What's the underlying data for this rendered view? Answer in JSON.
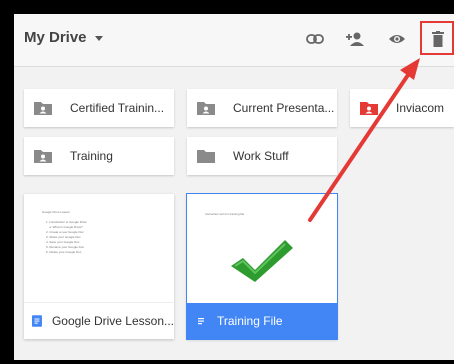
{
  "header": {
    "title": "My Drive",
    "icons": [
      "link-icon",
      "add-person-icon",
      "eye-icon",
      "trash-icon"
    ]
  },
  "folders": [
    {
      "label": "Certified Trainin...",
      "color": "#8a8a8a"
    },
    {
      "label": "Current Presenta...",
      "color": "#8a8a8a"
    },
    {
      "label": "Inviacom",
      "color": "#e53935"
    },
    {
      "label": "Training",
      "color": "#8a8a8a"
    },
    {
      "label": "Work Stuff",
      "color": "#8a8a8a"
    }
  ],
  "files": [
    {
      "label": "Google Drive Lesson...",
      "preview_title": "Google Drive Lesson",
      "preview_lines": [
        "1. Introduction to Google Drive",
        "    a. What is Google Drive?",
        "2. Create a new Google Doc",
        "3. Share your Google Doc",
        "4. Save your Google Doc",
        "5. Rename your Google Doc",
        "6. Delete your Google Doc"
      ]
    },
    {
      "label": "Training File",
      "preview_title": "Instruction text for training file",
      "selected": true
    }
  ],
  "colors": {
    "accent_blue": "#4285f4",
    "highlight_red": "#e53935",
    "check_green": "#2e9b2e"
  }
}
